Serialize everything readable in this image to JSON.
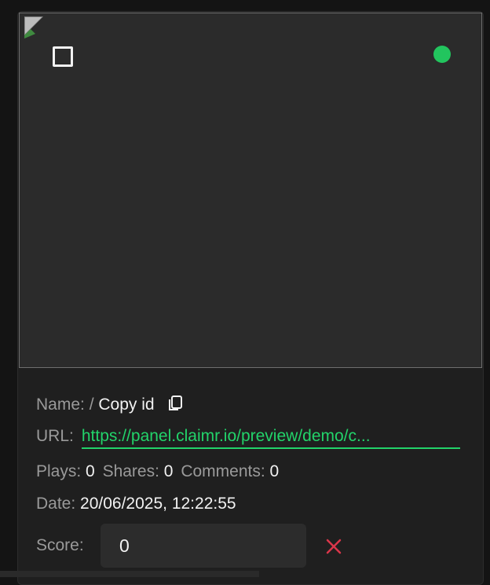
{
  "card": {
    "name_label": "Name:",
    "name_value": "/",
    "copy_id_label": "Copy id",
    "url_label": "URL:",
    "url_text": "https://panel.claimr.io/preview/demo/c...",
    "plays_label": "Plays:",
    "plays_value": "0",
    "shares_label": "Shares:",
    "shares_value": "0",
    "comments_label": "Comments:",
    "comments_value": "0",
    "date_label": "Date:",
    "date_value": "20/06/2025, 12:22:55",
    "score_label": "Score:",
    "score_value": "0"
  },
  "icons": {
    "copy": "copy-icon",
    "clear": "close-icon",
    "status": "status-dot",
    "broken_image": "broken-image-icon"
  },
  "colors": {
    "status": "#22c55e",
    "link": "#22d36a",
    "clear": "#d9364a"
  }
}
